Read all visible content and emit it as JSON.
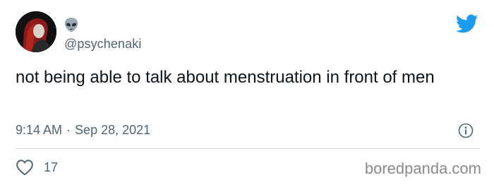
{
  "author": {
    "handle": "@psychenaki",
    "display_name_icon": "alien-emoji",
    "avatar": "avatar-image"
  },
  "tweet": {
    "text": "not being able to talk about menstruation in front of men",
    "time": "9:14 AM",
    "separator": "·",
    "date": "Sep 28, 2021"
  },
  "actions": {
    "like_icon": "heart-icon",
    "like_count": "17",
    "info_icon": "info-icon"
  },
  "platform": {
    "logo": "twitter-bird-icon",
    "accent_color": "#1d9bf0"
  },
  "watermark": {
    "text": "boredpanda.com"
  }
}
